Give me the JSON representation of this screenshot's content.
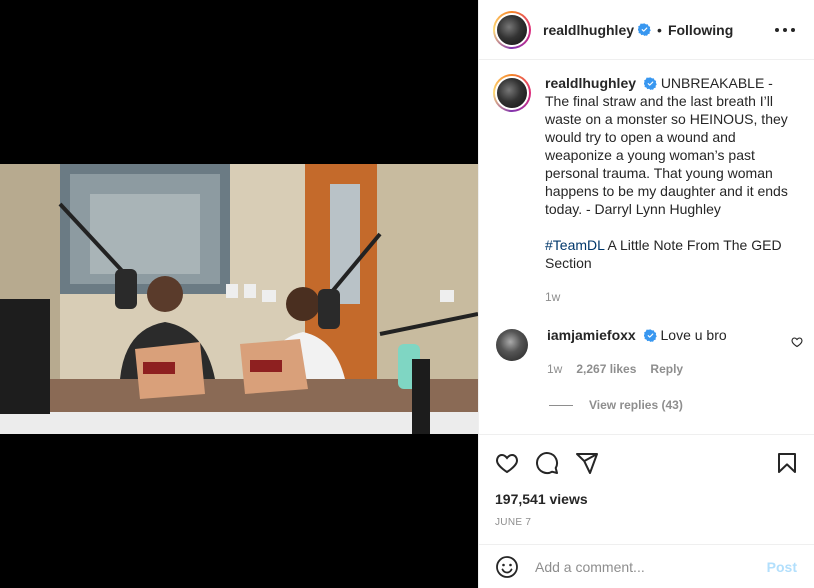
{
  "post": {
    "author": "realdlhughley",
    "follow_status": "Following",
    "separator": "•",
    "caption_text": "UNBREAKABLE - The final straw and the last breath I’ll waste on a monster so HEINOUS, they would try to open a wound and weaponize a young woman’s past personal trauma. That young woman happens to be my daughter and it ends today. - Darryl Lynn Hughley",
    "hashtag": "#TeamDL",
    "caption_tail": "A Little Note From The GED Section",
    "caption_age": "1w",
    "views": "197,541 views",
    "date": "JUNE 7"
  },
  "comment": {
    "author": "iamjamiefoxx",
    "text": "Love u bro",
    "age": "1w",
    "likes": "2,267 likes",
    "reply_label": "Reply",
    "view_replies": "View replies (43)"
  },
  "composer": {
    "placeholder": "Add a comment...",
    "post_label": "Post"
  },
  "icons": {
    "verified": "verified-badge-icon",
    "more": "more-options-icon",
    "like": "heart-icon",
    "comment": "comment-icon",
    "share": "share-icon",
    "save": "bookmark-icon",
    "emoji": "emoji-icon"
  },
  "colors": {
    "verified_blue": "#3897f0",
    "link_blue": "#00376b",
    "post_button_disabled": "#b2dffc",
    "muted_text": "#8e8e8e"
  }
}
